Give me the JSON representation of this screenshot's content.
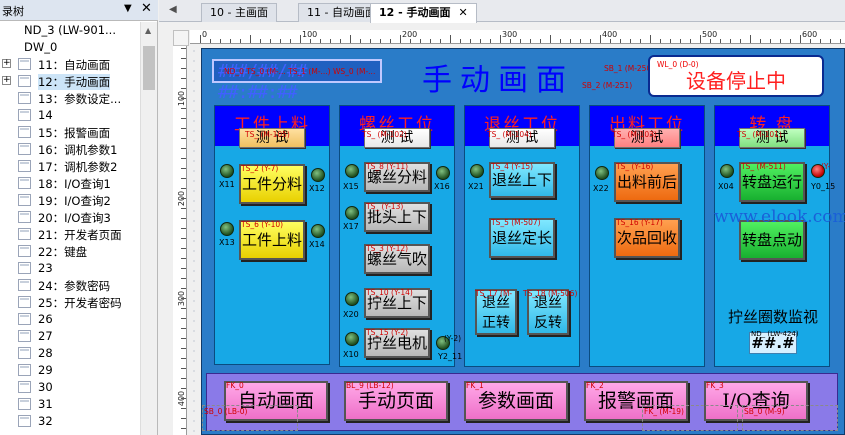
{
  "tree": {
    "header": "录树",
    "items": [
      {
        "label": "ND_3 (LW-901...",
        "indent": 1
      },
      {
        "label": "DW_0",
        "indent": 1
      },
      {
        "label": "11：自动画面",
        "expander": true
      },
      {
        "label": "12：手动画面",
        "expander": true,
        "selected": true
      },
      {
        "label": "13：参数设定..."
      },
      {
        "label": "14"
      },
      {
        "label": "15：报警画面"
      },
      {
        "label": "16：调机参数1"
      },
      {
        "label": "17：调机参数2"
      },
      {
        "label": "18：I/O查询1"
      },
      {
        "label": "19：I/O查询2"
      },
      {
        "label": "20：I/O查询3"
      },
      {
        "label": "21：开发者页面"
      },
      {
        "label": "22：键盘"
      },
      {
        "label": "23"
      },
      {
        "label": "24：参数密码"
      },
      {
        "label": "25：开发者密码"
      },
      {
        "label": "26"
      },
      {
        "label": "27"
      },
      {
        "label": "28"
      },
      {
        "label": "29"
      },
      {
        "label": "30"
      },
      {
        "label": "31"
      },
      {
        "label": "32"
      }
    ]
  },
  "tabs": [
    {
      "label": "10 - 主画面"
    },
    {
      "label": "11 - 自动画面"
    },
    {
      "label": "12 - 手动画面",
      "active": true
    }
  ],
  "ruler": {
    "x": [
      "0",
      "100",
      "200",
      "300",
      "400",
      "500",
      "600"
    ],
    "y": [
      "100",
      "200",
      "300",
      "400"
    ]
  },
  "screen": {
    "title": "手动画面",
    "status": "设备停止中",
    "status_tag": "WL_0 (D-0)",
    "sb1": "SB_1 (M-250)",
    "sb2": "SB_2 (M-251)",
    "datetime": "###/##/## ##:##:##",
    "datetime_tag": "ND_0 TS_0 (M-... TS_1 (M-...) WS_0 (M-...",
    "watermark": "www.elook.com",
    "monitor_label": "拧丝圈数监视",
    "monitor_value": "##.#",
    "monitor_tag": "ND_ (LW-424)"
  },
  "panels": {
    "workpiece": {
      "title": "工件上料",
      "test": "测 试",
      "test_tag": "TS_ (M-105)",
      "btn1": "工件分料",
      "btn1_tag": "TS_2 (Y-7)",
      "btn2": "工件上料",
      "btn2_tag": "TS_6 (Y-10)",
      "l1": "X11",
      "l2": "X12",
      "l3": "X13",
      "l4": "X14",
      "l5": "X13"
    },
    "screw": {
      "title": "螺丝工位",
      "test": "测 试",
      "test_tag": "TS_ (M-102)",
      "btn1": "螺丝分料",
      "btn1_tag": "TS_8 (Y-11)",
      "btn2": "批头上下",
      "btn2_tag": "TS_ (Y-13)",
      "btn3": "螺丝气吹",
      "btn3_tag": "TS_3 (Y-12)",
      "btn4": "拧丝上下",
      "btn4_tag": "TS_10 (Y-14)",
      "btn5": "拧丝电机",
      "btn5_tag": "TS_15 (Y-2)",
      "l1": "X15",
      "l2": "X16",
      "l3": "X17",
      "l4": "X20",
      "l5": "X10",
      "l6": "Y2_11",
      "r5": "(Y-2)"
    },
    "retract": {
      "title": "退丝工位",
      "test": "测 试",
      "test_tag": "TS_ (M-104)",
      "btn1": "退丝上下",
      "btn1_tag": "TS_4 (Y-15)",
      "btn2": "退丝定长",
      "btn2_tag": "TS_5 (M-507)",
      "btn3": "退丝正转",
      "btn3_tag": "TS_17 (M-",
      "btn4": "退丝反转",
      "btn4_tag": "TS_18 (M-506)",
      "l1": "X21"
    },
    "discharge": {
      "title": "出料工位",
      "test": "测 试",
      "test_tag": "TS_ (M-103)",
      "btn1": "出料前后",
      "btn1_tag": "TS_ (Y-16)",
      "btn2": "次品回收",
      "btn2_tag": "TS_16 (Y-17)",
      "l1": "X22"
    },
    "turntable": {
      "title": "转  盘",
      "test": "测 试",
      "test_tag": "TS_ (M-101)",
      "btn1": "转盘运行",
      "btn1_tag": "TS_ (M-511)",
      "btn2": "转盘点动",
      "l1": "X04",
      "l2": "Y0_15",
      "r1": "(Y-"
    }
  },
  "nav": [
    {
      "label": "自动画面",
      "tag": "FK_0"
    },
    {
      "label": "手动页面",
      "tag": "BL_9 (LB-12)"
    },
    {
      "label": "参数画面",
      "tag": "FK_1"
    },
    {
      "label": "报警画面",
      "tag": "FK_2"
    },
    {
      "label": "I/O查询",
      "tag": "FK_3"
    }
  ],
  "nav_extra": {
    "sb0": "SB_0 (LB-0)",
    "fk": "FK_ (M-19)",
    "sb": "SB_0 (M-9)"
  }
}
